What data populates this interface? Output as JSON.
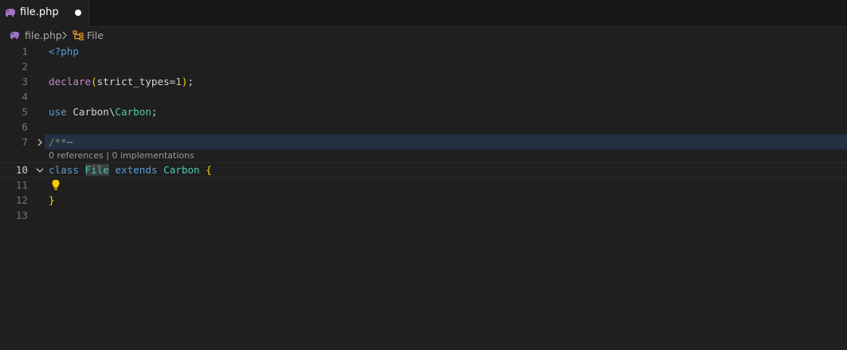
{
  "tab": {
    "label": "file.php",
    "dirty": true
  },
  "breadcrumb": {
    "file": "file.php",
    "symbol": "File"
  },
  "editor": {
    "lines": [
      {
        "num": "1"
      },
      {
        "num": "2"
      },
      {
        "num": "3"
      },
      {
        "num": "4"
      },
      {
        "num": "5"
      },
      {
        "num": "6"
      },
      {
        "num": "7"
      },
      {
        "num": "10"
      },
      {
        "num": "11"
      },
      {
        "num": "12"
      },
      {
        "num": "13"
      }
    ],
    "code": {
      "l1": "<?php",
      "l3_fn": "declare",
      "l3_open": "(",
      "l3_arg": "strict_types=",
      "l3_num": "1",
      "l3_close": ")",
      "l3_semi": ";",
      "l5_use": "use",
      "l5_ns": " Carbon\\",
      "l5_cls": "Carbon",
      "l5_semi": ";",
      "l7_comment": "/**",
      "l7_ellipsis": "⋯",
      "l10_class": "class",
      "l10_name": "File",
      "l10_extends": "extends",
      "l10_parent": "Carbon",
      "l10_brace": "{",
      "l12_brace": "}"
    },
    "codelens": "0 references | 0 implementations"
  },
  "colors": {
    "background": "#1f1f1f",
    "keyword": "#569cd6",
    "class": "#4ec9b0",
    "bracket": "#ffd700",
    "comment": "#6a9955",
    "folded_highlight": "#243042"
  }
}
